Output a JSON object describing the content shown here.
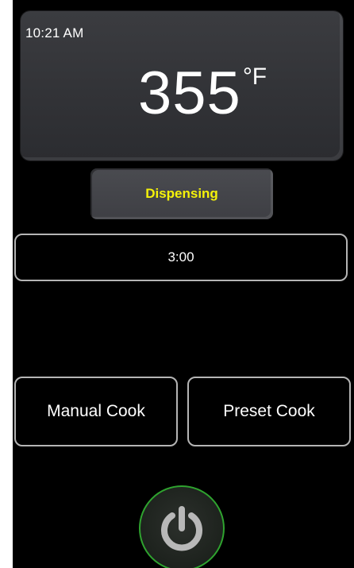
{
  "header": {
    "time": "10:21 AM",
    "temperature": "355",
    "unit": "°F"
  },
  "status": {
    "label": "Dispensing",
    "color": "#f5f20a"
  },
  "timer": {
    "value": "3:00"
  },
  "modes": {
    "manual_label": "Manual Cook",
    "preset_label": "Preset Cook"
  },
  "power": {
    "icon": "power-icon",
    "ring_color": "#2fa32f"
  }
}
